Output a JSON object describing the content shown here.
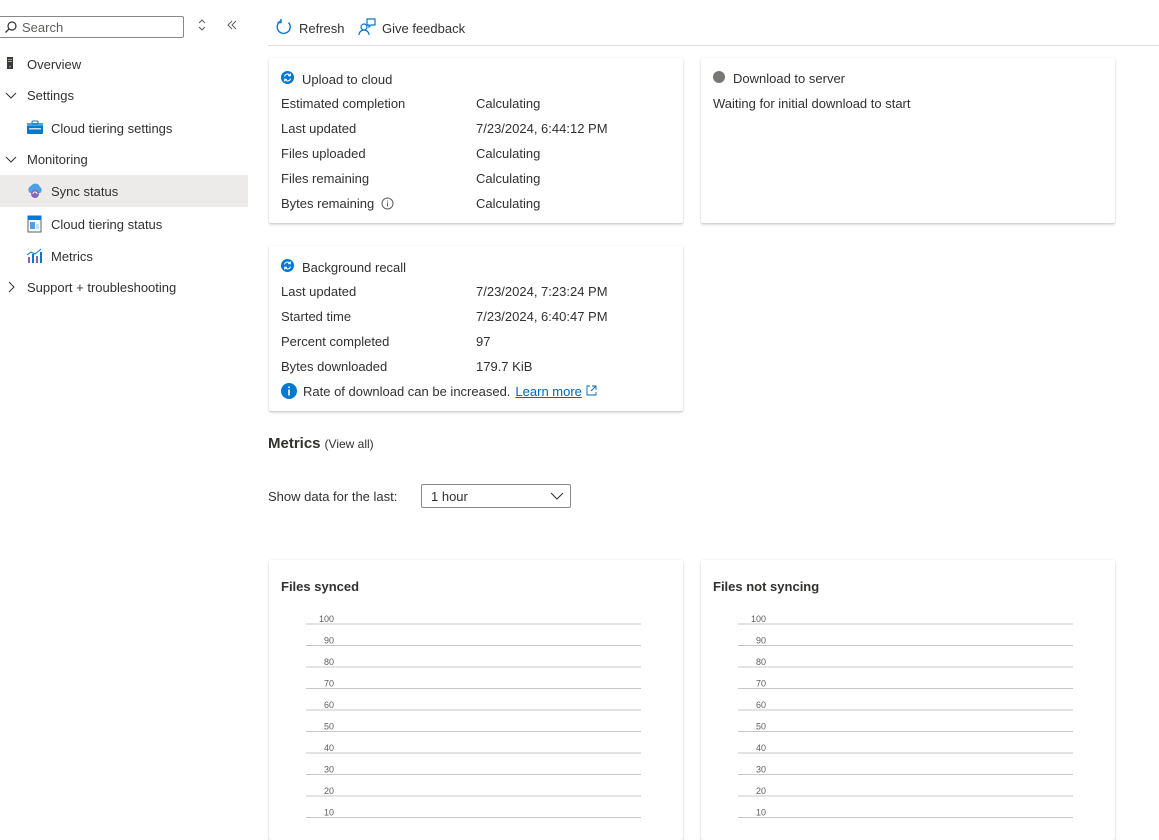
{
  "sidebar": {
    "search_placeholder": "Search",
    "items": [
      {
        "label": "Overview"
      },
      {
        "label": "Settings"
      },
      {
        "label": "Cloud tiering settings"
      },
      {
        "label": "Monitoring"
      },
      {
        "label": "Sync status"
      },
      {
        "label": "Cloud tiering status"
      },
      {
        "label": "Metrics"
      },
      {
        "label": "Support + troubleshooting"
      }
    ]
  },
  "toolbar": {
    "refresh_label": "Refresh",
    "feedback_label": "Give feedback"
  },
  "upload_card": {
    "title": "Upload to cloud",
    "rows": [
      {
        "label": "Estimated completion",
        "value": "Calculating"
      },
      {
        "label": "Last updated",
        "value": "7/23/2024, 6:44:12 PM"
      },
      {
        "label": "Files uploaded",
        "value": "Calculating"
      },
      {
        "label": "Files remaining",
        "value": "Calculating"
      },
      {
        "label": "Bytes remaining",
        "value": "Calculating"
      }
    ]
  },
  "download_card": {
    "title": "Download to server",
    "status_text": "Waiting for initial download to start"
  },
  "recall_card": {
    "title": "Background recall",
    "rows": [
      {
        "label": "Last updated",
        "value": "7/23/2024, 7:23:24 PM"
      },
      {
        "label": "Started time",
        "value": "7/23/2024, 6:40:47 PM"
      },
      {
        "label": "Percent completed",
        "value": "97"
      },
      {
        "label": "Bytes downloaded",
        "value": "179.7 KiB"
      }
    ],
    "info_text": "Rate of download can be increased.",
    "info_link": "Learn more"
  },
  "metrics": {
    "title": "Metrics",
    "view_all": "(View all)",
    "show_data_label": "Show data for the last:",
    "time_range": "1 hour"
  },
  "chart_data": [
    {
      "type": "line",
      "title": "Files synced",
      "ylim": [
        0,
        100
      ],
      "y_ticks": [
        "100",
        "90",
        "80",
        "70",
        "60",
        "50",
        "40",
        "30",
        "20",
        "10"
      ],
      "series": []
    },
    {
      "type": "line",
      "title": "Files not syncing",
      "ylim": [
        0,
        100
      ],
      "y_ticks": [
        "100",
        "90",
        "80",
        "70",
        "60",
        "50",
        "40",
        "30",
        "20",
        "10"
      ],
      "series": []
    }
  ],
  "colors": {
    "accent": "#0078d4",
    "link": "#0067b8",
    "selected_bg": "#edebe9",
    "status_gray": "#797775",
    "gridline": "#c8c6c4"
  }
}
